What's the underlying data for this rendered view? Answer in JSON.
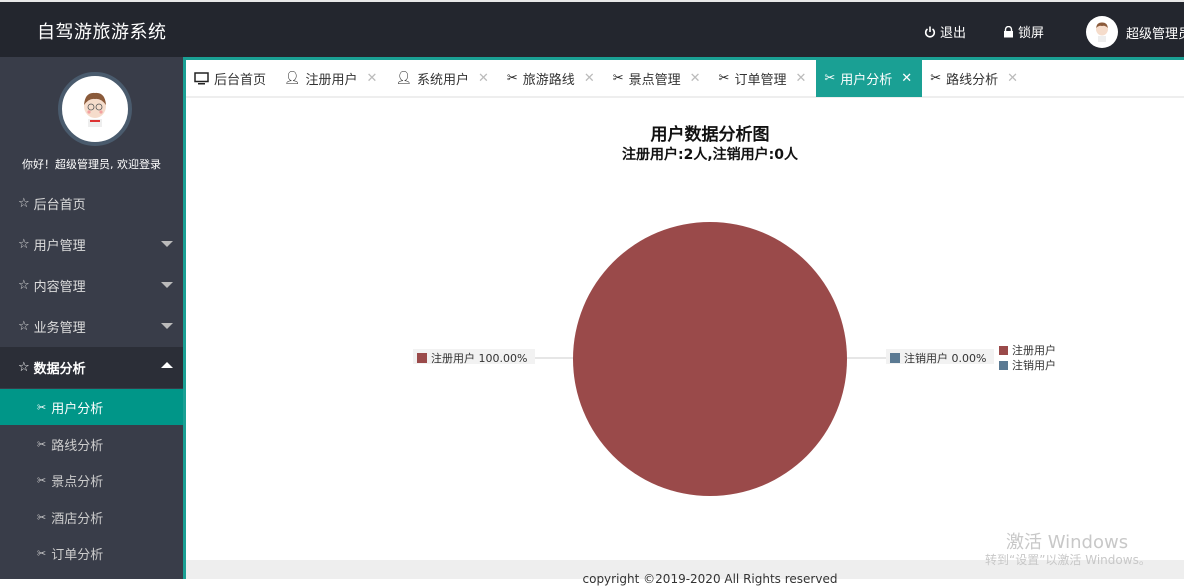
{
  "header": {
    "app_title": "自驾游旅游系统",
    "logout_label": "退出",
    "lock_label": "锁屏",
    "user_name": "超级管理员"
  },
  "sidebar": {
    "welcome": "你好！超级管理员, 欢迎登录",
    "items": [
      {
        "label": "后台首页",
        "icon": "star-outline-icon",
        "expandable": false
      },
      {
        "label": "用户管理",
        "icon": "star-outline-icon",
        "expandable": true,
        "expanded": false
      },
      {
        "label": "内容管理",
        "icon": "star-outline-icon",
        "expandable": true,
        "expanded": false
      },
      {
        "label": "业务管理",
        "icon": "star-outline-icon",
        "expandable": true,
        "expanded": false
      },
      {
        "label": "数据分析",
        "icon": "star-outline-icon",
        "expandable": true,
        "expanded": true
      }
    ],
    "sub_items": [
      {
        "label": "用户分析",
        "active": true
      },
      {
        "label": "路线分析",
        "active": false
      },
      {
        "label": "景点分析",
        "active": false
      },
      {
        "label": "酒店分析",
        "active": false
      },
      {
        "label": "订单分析",
        "active": false
      }
    ]
  },
  "tabs": [
    {
      "label": "后台首页",
      "icon": "monitor-icon",
      "closable": false,
      "active": false
    },
    {
      "label": "注册用户",
      "icon": "user-icon",
      "closable": true,
      "active": false
    },
    {
      "label": "系统用户",
      "icon": "user-icon",
      "closable": true,
      "active": false
    },
    {
      "label": "旅游路线",
      "icon": "tools-icon",
      "closable": true,
      "active": false
    },
    {
      "label": "景点管理",
      "icon": "tools-icon",
      "closable": true,
      "active": false
    },
    {
      "label": "订单管理",
      "icon": "tools-icon",
      "closable": true,
      "active": false
    },
    {
      "label": "用户分析",
      "icon": "tools-icon",
      "closable": true,
      "active": true
    },
    {
      "label": "路线分析",
      "icon": "tools-icon",
      "closable": true,
      "active": false
    }
  ],
  "colors": {
    "accent": "#009688",
    "tab_active": "#1aa094",
    "header_bg": "#23262e",
    "sidebar_bg": "#393d49",
    "registered": "#9a4a4a",
    "cancelled": "#5b7a93"
  },
  "chart_data": {
    "type": "pie",
    "title": "用户数据分析图",
    "subtitle": "注册用户:2人,注销用户:0人",
    "categories": [
      "注册用户",
      "注销用户"
    ],
    "values": [
      2,
      0
    ],
    "percent_labels": [
      "注册用户 100.00%",
      "注销用户 0.00%"
    ],
    "colors": [
      "#9a4a4a",
      "#5b7a93"
    ],
    "legend": {
      "position": "right",
      "entries": [
        "注册用户",
        "注销用户"
      ]
    }
  },
  "footer": {
    "copyright": "copyright ©2019-2020 All Rights reserved"
  },
  "watermark": {
    "line1": "激活 Windows",
    "line2": "转到“设置”以激活 Windows。"
  }
}
